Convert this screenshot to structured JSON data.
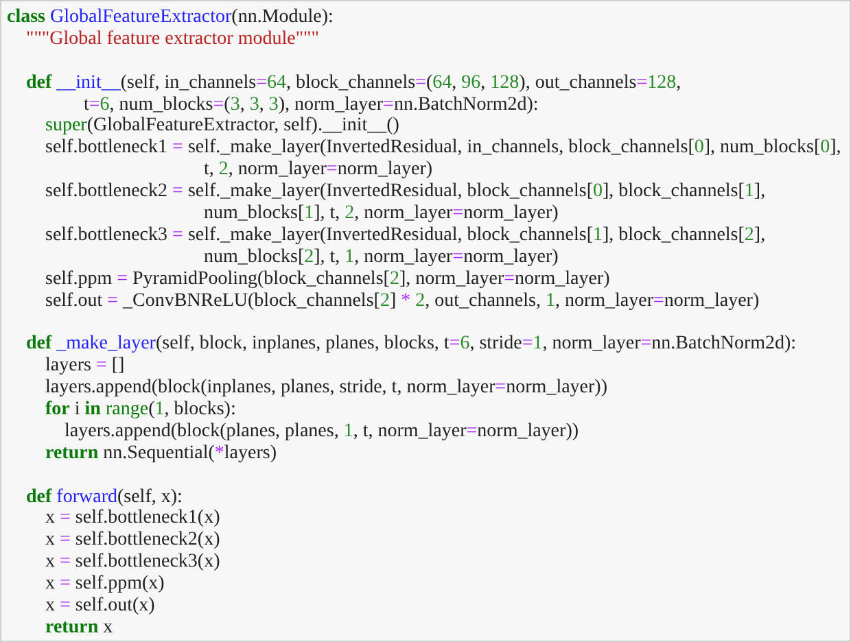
{
  "code_lines": [
    {
      "kind": "code",
      "tokens": [
        {
          "kind": "keyword",
          "text": "class"
        },
        {
          "kind": "name",
          "text": " GlobalFeatureExtractor"
        },
        {
          "kind": "plain",
          "text": "(nn.Module):"
        }
      ]
    },
    {
      "kind": "code",
      "tokens": [
        {
          "kind": "string",
          "text": "    \"\"\"Global feature extractor module\"\"\""
        }
      ]
    },
    {
      "kind": "blank"
    },
    {
      "kind": "code",
      "tokens": [
        {
          "kind": "keyword",
          "text": "    def"
        },
        {
          "kind": "name",
          "text": " __init__"
        },
        {
          "kind": "plain",
          "text": "(self, in_channels"
        },
        {
          "kind": "operator",
          "text": "="
        },
        {
          "kind": "number",
          "text": "64"
        },
        {
          "kind": "plain",
          "text": ", block_channels"
        },
        {
          "kind": "operator",
          "text": "="
        },
        {
          "kind": "plain",
          "text": "("
        },
        {
          "kind": "number",
          "text": "64"
        },
        {
          "kind": "plain",
          "text": ", "
        },
        {
          "kind": "number",
          "text": "96"
        },
        {
          "kind": "plain",
          "text": ", "
        },
        {
          "kind": "number",
          "text": "128"
        },
        {
          "kind": "plain",
          "text": "), out_channels"
        },
        {
          "kind": "operator",
          "text": "="
        },
        {
          "kind": "number",
          "text": "128"
        },
        {
          "kind": "plain",
          "text": ","
        }
      ]
    },
    {
      "kind": "code",
      "tokens": [
        {
          "kind": "plain",
          "text": "                t"
        },
        {
          "kind": "operator",
          "text": "="
        },
        {
          "kind": "number",
          "text": "6"
        },
        {
          "kind": "plain",
          "text": ", num_blocks"
        },
        {
          "kind": "operator",
          "text": "="
        },
        {
          "kind": "plain",
          "text": "("
        },
        {
          "kind": "number",
          "text": "3"
        },
        {
          "kind": "plain",
          "text": ", "
        },
        {
          "kind": "number",
          "text": "3"
        },
        {
          "kind": "plain",
          "text": ", "
        },
        {
          "kind": "number",
          "text": "3"
        },
        {
          "kind": "plain",
          "text": "), norm_layer"
        },
        {
          "kind": "operator",
          "text": "="
        },
        {
          "kind": "plain",
          "text": "nn.BatchNorm2d):"
        }
      ]
    },
    {
      "kind": "code",
      "tokens": [
        {
          "kind": "builtin",
          "text": "        super"
        },
        {
          "kind": "plain",
          "text": "(GlobalFeatureExtractor, self).__init__()"
        }
      ]
    },
    {
      "kind": "code",
      "tokens": [
        {
          "kind": "plain",
          "text": "        self.bottleneck1 "
        },
        {
          "kind": "operator",
          "text": "="
        },
        {
          "kind": "plain",
          "text": " self._make_layer(InvertedResidual, in_channels, block_channels["
        },
        {
          "kind": "number",
          "text": "0"
        },
        {
          "kind": "plain",
          "text": "], num_blocks["
        },
        {
          "kind": "number",
          "text": "0"
        },
        {
          "kind": "plain",
          "text": "],"
        }
      ]
    },
    {
      "kind": "code",
      "tokens": [
        {
          "kind": "plain",
          "text": "                                         t, "
        },
        {
          "kind": "number",
          "text": "2"
        },
        {
          "kind": "plain",
          "text": ", norm_layer"
        },
        {
          "kind": "operator",
          "text": "="
        },
        {
          "kind": "plain",
          "text": "norm_layer)"
        }
      ]
    },
    {
      "kind": "code",
      "tokens": [
        {
          "kind": "plain",
          "text": "        self.bottleneck2 "
        },
        {
          "kind": "operator",
          "text": "="
        },
        {
          "kind": "plain",
          "text": " self._make_layer(InvertedResidual, block_channels["
        },
        {
          "kind": "number",
          "text": "0"
        },
        {
          "kind": "plain",
          "text": "], block_channels["
        },
        {
          "kind": "number",
          "text": "1"
        },
        {
          "kind": "plain",
          "text": "],"
        }
      ]
    },
    {
      "kind": "code",
      "tokens": [
        {
          "kind": "plain",
          "text": "                                         num_blocks["
        },
        {
          "kind": "number",
          "text": "1"
        },
        {
          "kind": "plain",
          "text": "], t, "
        },
        {
          "kind": "number",
          "text": "2"
        },
        {
          "kind": "plain",
          "text": ", norm_layer"
        },
        {
          "kind": "operator",
          "text": "="
        },
        {
          "kind": "plain",
          "text": "norm_layer)"
        }
      ]
    },
    {
      "kind": "code",
      "tokens": [
        {
          "kind": "plain",
          "text": "        self.bottleneck3 "
        },
        {
          "kind": "operator",
          "text": "="
        },
        {
          "kind": "plain",
          "text": " self._make_layer(InvertedResidual, block_channels["
        },
        {
          "kind": "number",
          "text": "1"
        },
        {
          "kind": "plain",
          "text": "], block_channels["
        },
        {
          "kind": "number",
          "text": "2"
        },
        {
          "kind": "plain",
          "text": "],"
        }
      ]
    },
    {
      "kind": "code",
      "tokens": [
        {
          "kind": "plain",
          "text": "                                         num_blocks["
        },
        {
          "kind": "number",
          "text": "2"
        },
        {
          "kind": "plain",
          "text": "], t, "
        },
        {
          "kind": "number",
          "text": "1"
        },
        {
          "kind": "plain",
          "text": ", norm_layer"
        },
        {
          "kind": "operator",
          "text": "="
        },
        {
          "kind": "plain",
          "text": "norm_layer)"
        }
      ]
    },
    {
      "kind": "code",
      "tokens": [
        {
          "kind": "plain",
          "text": "        self.ppm "
        },
        {
          "kind": "operator",
          "text": "="
        },
        {
          "kind": "plain",
          "text": " PyramidPooling(block_channels["
        },
        {
          "kind": "number",
          "text": "2"
        },
        {
          "kind": "plain",
          "text": "], norm_layer"
        },
        {
          "kind": "operator",
          "text": "="
        },
        {
          "kind": "plain",
          "text": "norm_layer)"
        }
      ]
    },
    {
      "kind": "code",
      "tokens": [
        {
          "kind": "plain",
          "text": "        self.out "
        },
        {
          "kind": "operator",
          "text": "="
        },
        {
          "kind": "plain",
          "text": " _ConvBNReLU(block_channels["
        },
        {
          "kind": "number",
          "text": "2"
        },
        {
          "kind": "plain",
          "text": "] "
        },
        {
          "kind": "operator",
          "text": "*"
        },
        {
          "kind": "number",
          "text": " 2"
        },
        {
          "kind": "plain",
          "text": ", out_channels, "
        },
        {
          "kind": "number",
          "text": "1"
        },
        {
          "kind": "plain",
          "text": ", norm_layer"
        },
        {
          "kind": "operator",
          "text": "="
        },
        {
          "kind": "plain",
          "text": "norm_layer)"
        }
      ]
    },
    {
      "kind": "blank"
    },
    {
      "kind": "code",
      "tokens": [
        {
          "kind": "keyword",
          "text": "    def"
        },
        {
          "kind": "name",
          "text": " _make_layer"
        },
        {
          "kind": "plain",
          "text": "(self, block, inplanes, planes, blocks, t"
        },
        {
          "kind": "operator",
          "text": "="
        },
        {
          "kind": "number",
          "text": "6"
        },
        {
          "kind": "plain",
          "text": ", stride"
        },
        {
          "kind": "operator",
          "text": "="
        },
        {
          "kind": "number",
          "text": "1"
        },
        {
          "kind": "plain",
          "text": ", norm_layer"
        },
        {
          "kind": "operator",
          "text": "="
        },
        {
          "kind": "plain",
          "text": "nn.BatchNorm2d):"
        }
      ]
    },
    {
      "kind": "code",
      "tokens": [
        {
          "kind": "plain",
          "text": "        layers "
        },
        {
          "kind": "operator",
          "text": "="
        },
        {
          "kind": "plain",
          "text": " []"
        }
      ]
    },
    {
      "kind": "code",
      "tokens": [
        {
          "kind": "plain",
          "text": "        layers.append(block(inplanes, planes, stride, t, norm_layer"
        },
        {
          "kind": "operator",
          "text": "="
        },
        {
          "kind": "plain",
          "text": "norm_layer))"
        }
      ]
    },
    {
      "kind": "code",
      "tokens": [
        {
          "kind": "keyword",
          "text": "        for"
        },
        {
          "kind": "plain",
          "text": " i "
        },
        {
          "kind": "keyword",
          "text": "in"
        },
        {
          "kind": "builtin",
          "text": " range"
        },
        {
          "kind": "plain",
          "text": "("
        },
        {
          "kind": "number",
          "text": "1"
        },
        {
          "kind": "plain",
          "text": ", blocks):"
        }
      ]
    },
    {
      "kind": "code",
      "tokens": [
        {
          "kind": "plain",
          "text": "            layers.append(block(planes, planes, "
        },
        {
          "kind": "number",
          "text": "1"
        },
        {
          "kind": "plain",
          "text": ", t, norm_layer"
        },
        {
          "kind": "operator",
          "text": "="
        },
        {
          "kind": "plain",
          "text": "norm_layer))"
        }
      ]
    },
    {
      "kind": "code",
      "tokens": [
        {
          "kind": "keyword",
          "text": "        return"
        },
        {
          "kind": "plain",
          "text": " nn.Sequential("
        },
        {
          "kind": "operator",
          "text": "*"
        },
        {
          "kind": "plain",
          "text": "layers)"
        }
      ]
    },
    {
      "kind": "blank"
    },
    {
      "kind": "code",
      "tokens": [
        {
          "kind": "keyword",
          "text": "    def"
        },
        {
          "kind": "name",
          "text": " forward"
        },
        {
          "kind": "plain",
          "text": "(self, x):"
        }
      ]
    },
    {
      "kind": "code",
      "tokens": [
        {
          "kind": "plain",
          "text": "        x "
        },
        {
          "kind": "operator",
          "text": "="
        },
        {
          "kind": "plain",
          "text": " self.bottleneck1(x)"
        }
      ]
    },
    {
      "kind": "code",
      "tokens": [
        {
          "kind": "plain",
          "text": "        x "
        },
        {
          "kind": "operator",
          "text": "="
        },
        {
          "kind": "plain",
          "text": " self.bottleneck2(x)"
        }
      ]
    },
    {
      "kind": "code",
      "tokens": [
        {
          "kind": "plain",
          "text": "        x "
        },
        {
          "kind": "operator",
          "text": "="
        },
        {
          "kind": "plain",
          "text": " self.bottleneck3(x)"
        }
      ]
    },
    {
      "kind": "code",
      "tokens": [
        {
          "kind": "plain",
          "text": "        x "
        },
        {
          "kind": "operator",
          "text": "="
        },
        {
          "kind": "plain",
          "text": " self.ppm(x)"
        }
      ]
    },
    {
      "kind": "code",
      "tokens": [
        {
          "kind": "plain",
          "text": "        x "
        },
        {
          "kind": "operator",
          "text": "="
        },
        {
          "kind": "plain",
          "text": " self.out(x)"
        }
      ]
    },
    {
      "kind": "code",
      "tokens": [
        {
          "kind": "keyword",
          "text": "        return"
        },
        {
          "kind": "plain",
          "text": " x"
        }
      ]
    }
  ]
}
